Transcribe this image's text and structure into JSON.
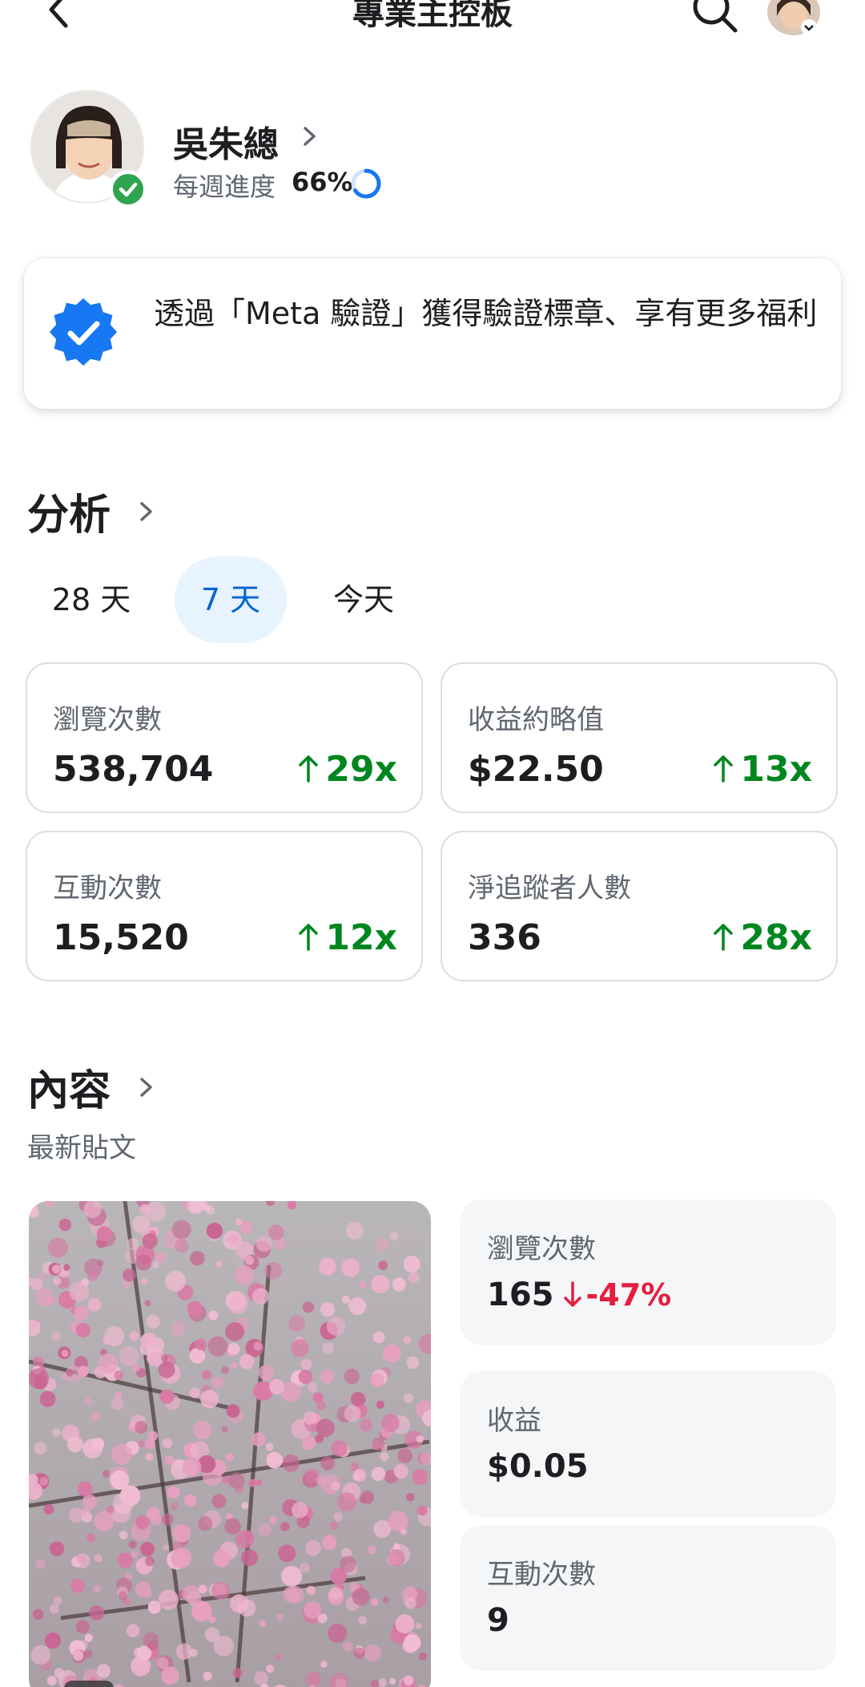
{
  "header": {
    "title": "專業主控板",
    "back_icon": "chevron-left-icon",
    "search_icon": "search-icon"
  },
  "profile": {
    "name": "吳朱總",
    "weekly_label": "每週進度",
    "weekly_value": "66%",
    "weekly_progress": 0.66
  },
  "meta_banner": {
    "text": "透過「Meta 驗證」獲得驗證標章、享有更多福利",
    "badge_color": "#1877f2"
  },
  "analytics": {
    "title": "分析",
    "tabs": [
      {
        "label": "28 天",
        "active": false
      },
      {
        "label": "7 天",
        "active": true
      },
      {
        "label": "今天",
        "active": false
      }
    ],
    "metrics": [
      {
        "label": "瀏覽次數",
        "value": "538,704",
        "change": "29x",
        "direction": "up"
      },
      {
        "label": "收益約略值",
        "value": "$22.50",
        "change": "13x",
        "direction": "up"
      },
      {
        "label": "互動次數",
        "value": "15,520",
        "change": "12x",
        "direction": "up"
      },
      {
        "label": "淨追蹤者人數",
        "value": "336",
        "change": "28x",
        "direction": "up"
      }
    ],
    "positive_color": "#00861f"
  },
  "content": {
    "title": "內容",
    "subtitle": "最新貼文",
    "stats": [
      {
        "label": "瀏覽次數",
        "value": "165",
        "change": "-47%",
        "direction": "down"
      },
      {
        "label": "收益",
        "value": "$0.05"
      },
      {
        "label": "互動次數",
        "value": "9"
      }
    ],
    "negative_color": "#e41e3f"
  }
}
